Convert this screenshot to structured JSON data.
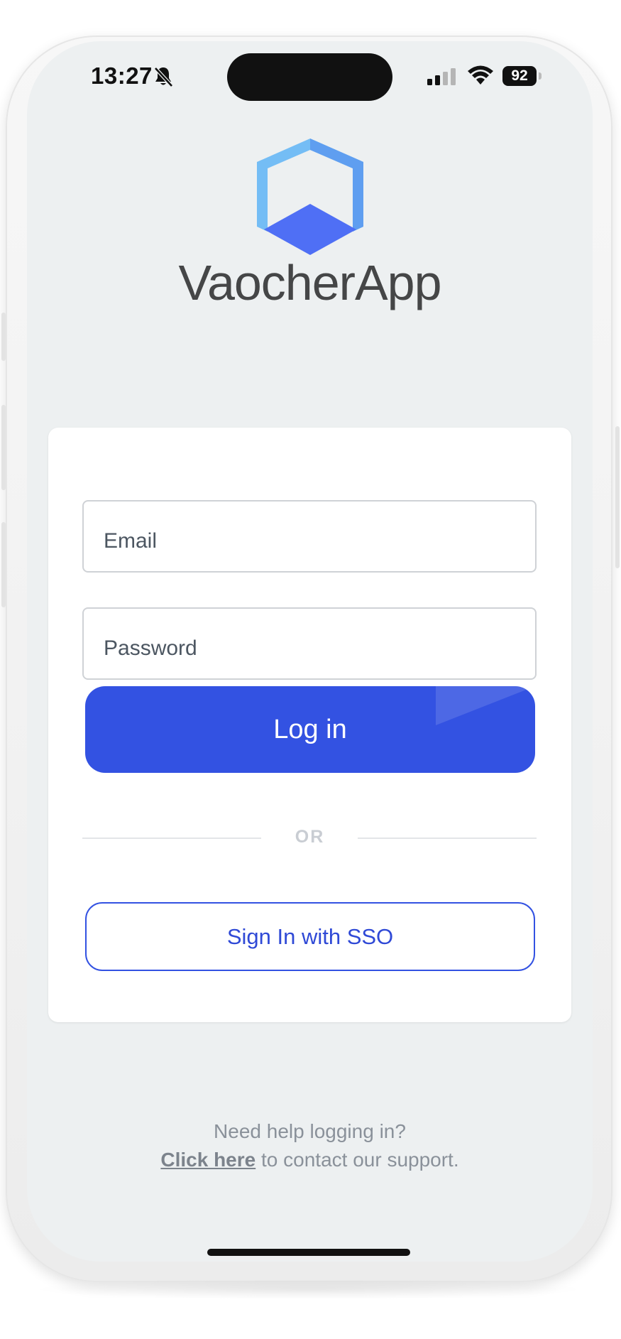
{
  "status_bar": {
    "time": "13:27",
    "battery": "92"
  },
  "brand": {
    "name": "VaocherApp"
  },
  "login_form": {
    "email_placeholder": "Email",
    "password_placeholder": "Password",
    "login_label": "Log in",
    "or_label": "OR",
    "sso_label": "Sign In with SSO"
  },
  "help": {
    "line1": "Need help logging in?",
    "link": "Click here",
    "line2_rest": " to contact our support."
  },
  "colors": {
    "primary": "#3352e2",
    "background": "#edf0f1",
    "logo_light": "#74bdf5",
    "logo_dark": "#4f6ff5"
  }
}
